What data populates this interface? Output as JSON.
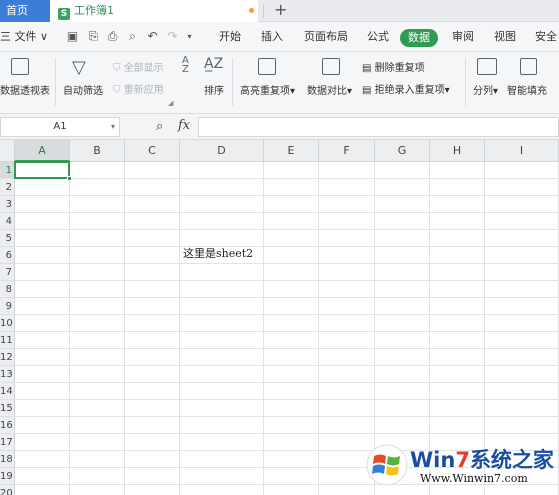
{
  "tabs": {
    "home": "首页",
    "document": "工作簿1",
    "new_tab": "+"
  },
  "menu": {
    "file": "三 文件 ∨",
    "items": [
      "开始",
      "插入",
      "页面布局",
      "公式",
      "数据",
      "审阅",
      "视图",
      "安全"
    ],
    "active": "数据"
  },
  "ribbon": {
    "pivot": "数据透视表",
    "autofilter": "自动筛选",
    "show_all": "全部显示",
    "reapply": "重新应用",
    "sort": "排序",
    "highlight_dup": "高亮重复项",
    "compare": "数据对比",
    "remove_dup": "删除重复项",
    "reject_dup": "拒绝录入重复项",
    "split": "分列",
    "smart_fill": "智能填充"
  },
  "formula_bar": {
    "name_box": "A1",
    "fx": "fx",
    "formula": ""
  },
  "grid": {
    "columns": [
      "A",
      "B",
      "C",
      "D",
      "E",
      "F",
      "G",
      "H",
      "I"
    ],
    "rows": [
      "1",
      "2",
      "3",
      "4",
      "5",
      "6",
      "7",
      "8",
      "9",
      "10",
      "11",
      "12",
      "13",
      "14",
      "15",
      "16",
      "17",
      "18",
      "19",
      "20"
    ],
    "selected_cell": "A1",
    "cells": {
      "D6": "这里是sheet2"
    }
  },
  "watermark": {
    "title_prefix": "Win",
    "title_seven": "7",
    "title_suffix": "系统之家",
    "url": "Www.Winwin7.com"
  },
  "colors": {
    "accent_green": "#2f9b53",
    "home_tab_blue": "#3c7dd8"
  }
}
